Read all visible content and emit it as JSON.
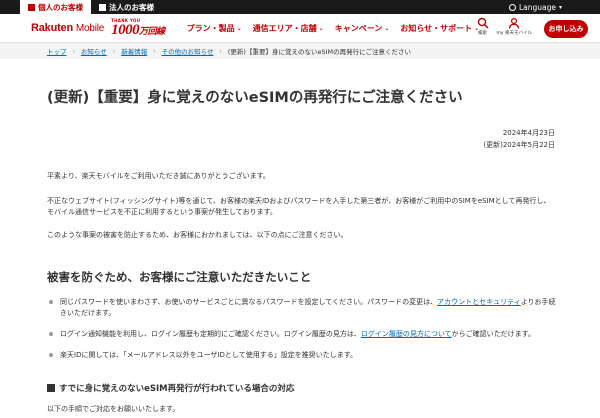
{
  "topbar": {
    "personal": "個人のお客様",
    "business": "法人のお客様",
    "language": "Language"
  },
  "header": {
    "logo_brand": "Rakuten",
    "logo_product": "Mobile",
    "badge_small": "THANK YOU",
    "badge_number": "1000",
    "badge_unit": "万回線",
    "nav": [
      "プラン・製品",
      "通信エリア・店舗",
      "キャンペーン",
      "お知らせ・サポート"
    ],
    "search_label": "検索",
    "account_label": "my 楽天モバイル",
    "apply_button": "お申し込み"
  },
  "breadcrumb": {
    "items": [
      "トップ",
      "お知らせ",
      "新着情報",
      "その他のお知らせ"
    ],
    "current": "(更新)【重要】身に覚えのないeSIMの再発行にご注意ください"
  },
  "article": {
    "title": "(更新)【重要】身に覚えのないeSIMの再発行にご注意ください",
    "date_published": "2024年4月23日",
    "date_updated": "(更新)2024年5月22日",
    "para1": "平素より、楽天モバイルをご利用いただき誠にありがとうございます。",
    "para2": "不正なウェブサイト(フィッシングサイト)等を通じて、お客様の楽天IDおよびパスワードを入手した第三者が、お客様がご利用中のSIMをeSIMとして再発行し、モバイル通信サービスを不正に利用するという事案が発生しております。",
    "para3": "このような事案の被害を防止するため、お客様におかれましては、以下の点にご注意ください。",
    "section_title": "被害を防ぐため、お客様にご注意いただきたいこと",
    "bullets": [
      {
        "pre": "同じパスワードを使いまわさず、お使いのサービスごとに異なるパスワードを設定してください。パスワードの変更は、",
        "link": "アカウントとセキュリティ",
        "post": "よりお手続きいただけます。"
      },
      {
        "pre": "ログイン通知機能を利用し、ログイン履歴も定期的にご確認ください。ログイン履歴の見方は、",
        "link": "ログイン履歴の見方について",
        "post": "からご確認いただけます。"
      },
      {
        "pre": "楽天IDに関しては、「メールアドレス以外をユーザIDとして使用する」設定を推奨いたします。",
        "link": "",
        "post": ""
      }
    ],
    "subsection_title": "すでに身に覚えのないeSIM再発行が行われている場合の対応",
    "para4": "以下の手順でご対応をお願いいたします。"
  },
  "colors": {
    "brand": "#bf0000",
    "link": "#0068b7",
    "topbar": "#1a1a1a"
  }
}
